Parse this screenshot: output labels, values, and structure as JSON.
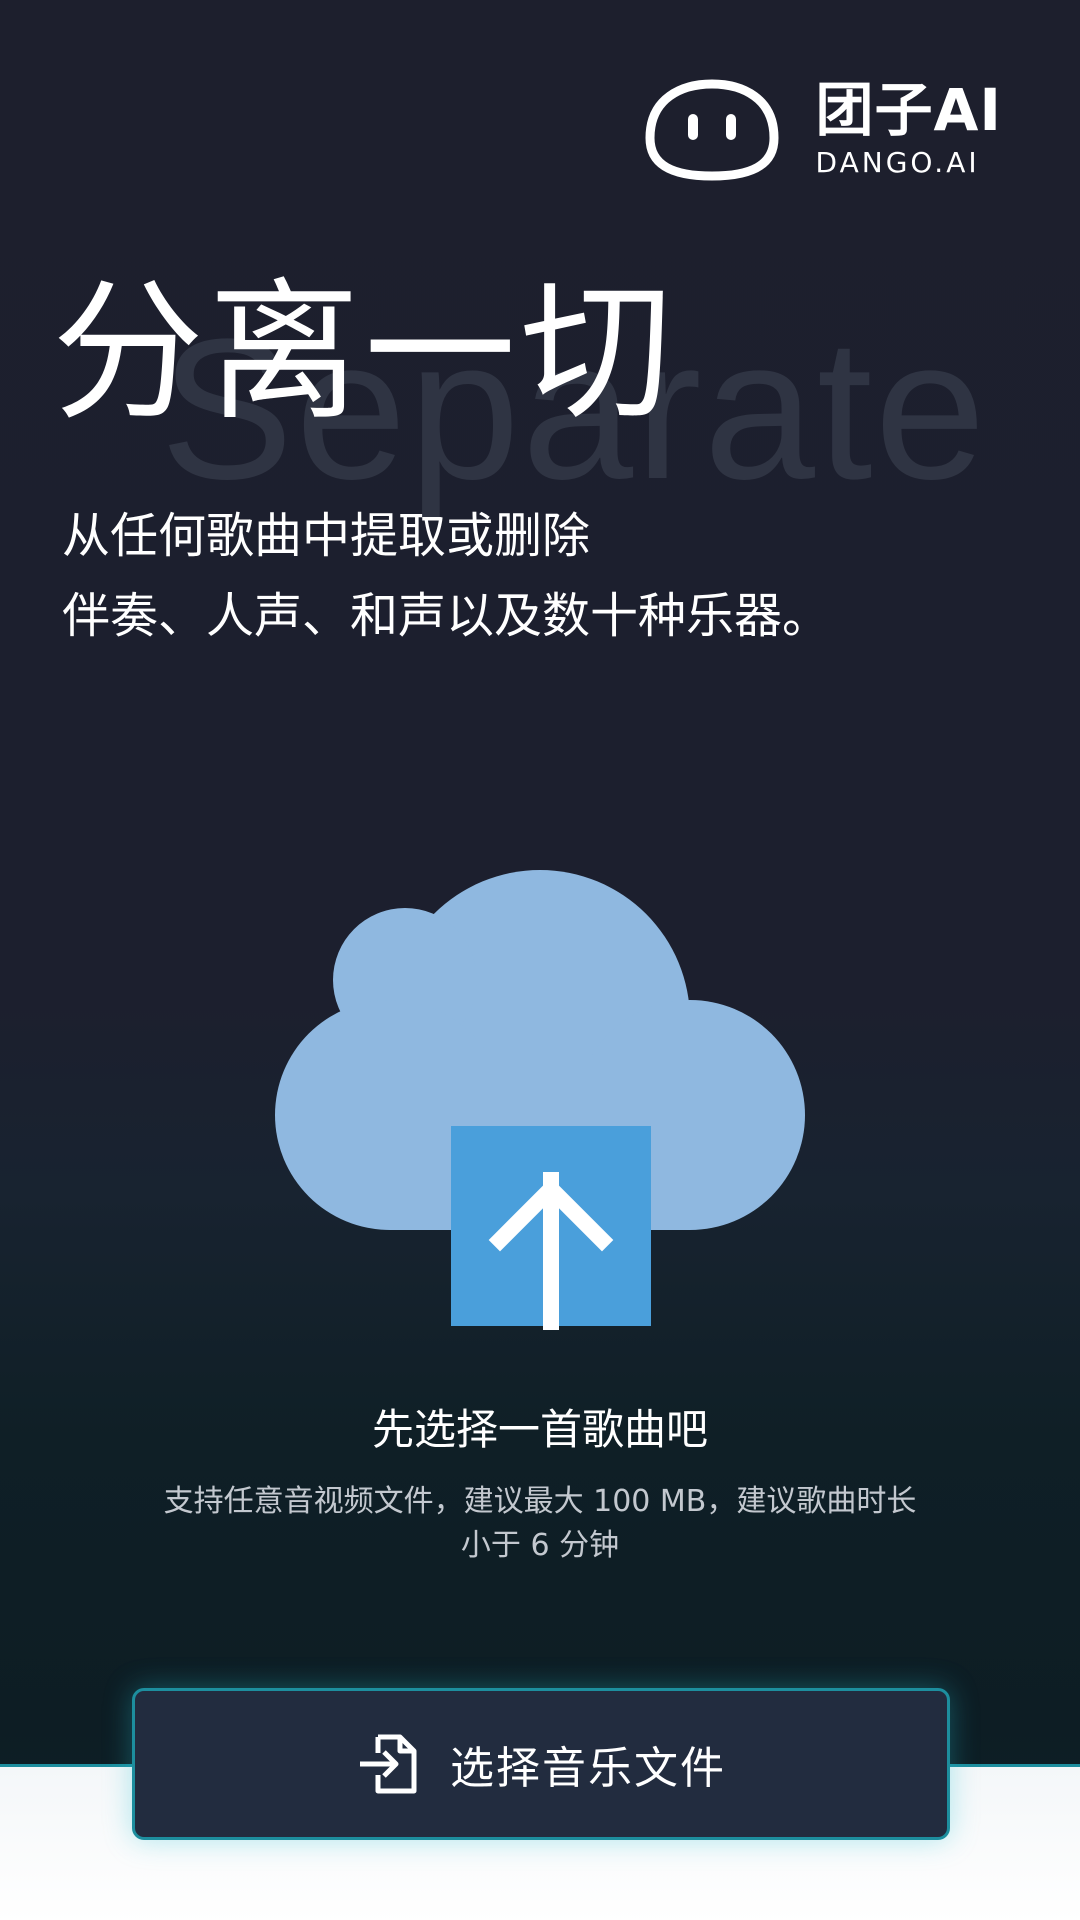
{
  "brand": {
    "name_cn": "团子AI",
    "name_en": "DANGO.AI",
    "logo_icon": "dango-face-icon"
  },
  "hero": {
    "watermark": "Separate",
    "title": "分离一切",
    "subtitle_lines": [
      "从任何歌曲中提取或删除",
      "伴奏、人声、和声以及数十种乐器。"
    ]
  },
  "upload": {
    "icon": "cloud-upload-icon",
    "prompt_title": "先选择一首歌曲吧",
    "prompt_desc": "支持任意音视频文件，建议最大 100 MB，建议歌曲时长小于 6 分钟"
  },
  "action": {
    "icon": "file-import-icon",
    "label": "选择音乐文件"
  },
  "colors": {
    "background": "#1d1f2d",
    "cloud": "#8fb8e0",
    "upload_box": "#4a9fdb",
    "accent": "#1d8e9e",
    "button_bg": "#222c3f"
  }
}
